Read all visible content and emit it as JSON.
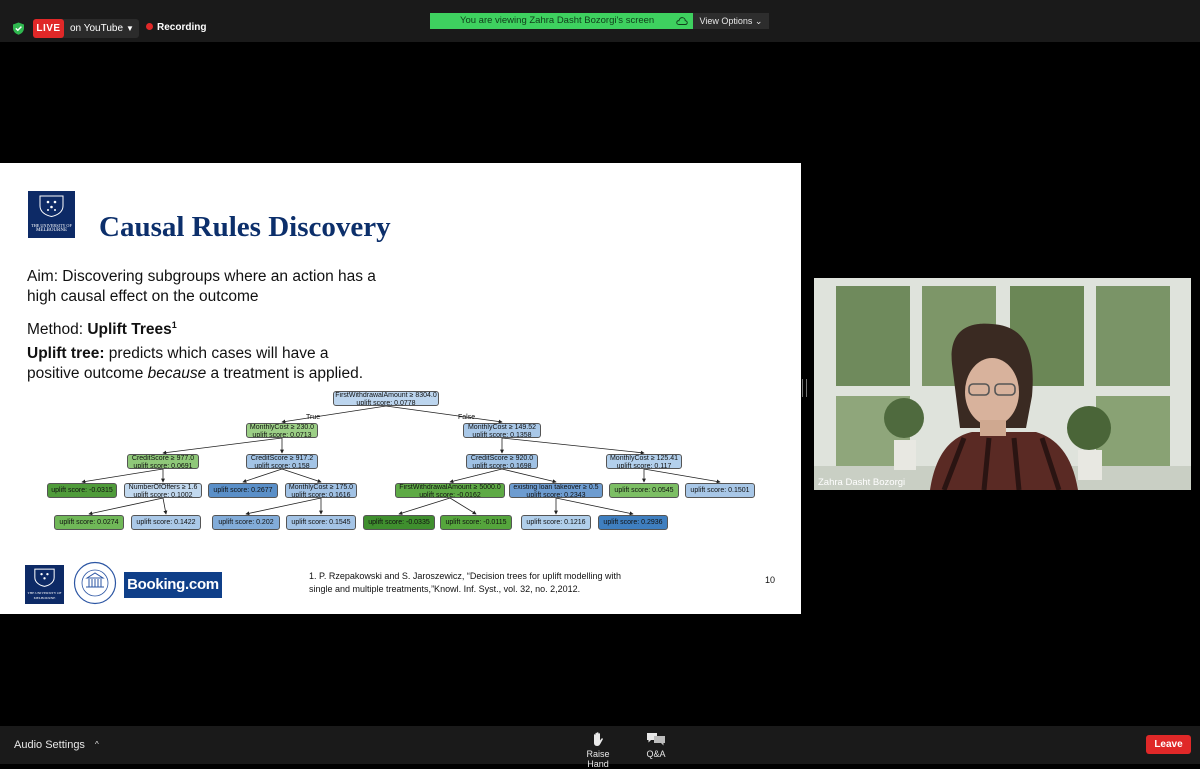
{
  "topbar": {
    "live_badge": "LIVE",
    "live_target": "on YouTube",
    "recording": "Recording",
    "viewing_banner": "You are viewing Zahra Dasht Bozorgi's screen",
    "view_options": "View Options ⌄"
  },
  "slide": {
    "crest_caption_1": "THE UNIVERSITY OF",
    "crest_caption_2": "MELBOURNE",
    "title": "Causal Rules Discovery",
    "aim_line1": "Aim: Discovering subgroups where an action has a",
    "aim_line2": "high causal effect on the outcome",
    "method_prefix": "Method: ",
    "method_bold": "Uplift Trees",
    "method_sup": "1",
    "uplift_bold": "Uplift tree:",
    "uplift_line1_rest": " predicts which cases will have a",
    "uplift_line2_a": "positive outcome ",
    "uplift_line2_em": "because",
    "uplift_line2_b": " a treatment is applied.",
    "tree": {
      "edge_true": "True",
      "edge_false": "False",
      "nodes": [
        {
          "id": "root",
          "l1": "FirstWithdrawalAmount ≥ 8304.0",
          "l2": "uplift score: 0.0778",
          "color": "#bcd5ee"
        },
        {
          "id": "n1",
          "l1": "MonthlyCost ≥ 230.0",
          "l2": "uplift score: 0.0713",
          "color": "#9ccf86"
        },
        {
          "id": "n2",
          "l1": "MonthlyCost ≥ 149.52",
          "l2": "uplift score: 0.1358",
          "color": "#a9c8e8"
        },
        {
          "id": "n3",
          "l1": "CreditScore ≥ 977.0",
          "l2": "uplift score: 0.0691",
          "color": "#8fc879"
        },
        {
          "id": "n4",
          "l1": "CreditScore ≥ 917.2",
          "l2": "uplift score: 0.158",
          "color": "#a3c4e6"
        },
        {
          "id": "n5",
          "l1": "CreditScore ≥ 920.0",
          "l2": "uplift score: 0.1698",
          "color": "#9fc1e4"
        },
        {
          "id": "n6",
          "l1": "MonthlyCost ≥ 125.41",
          "l2": "uplift score: 0.117",
          "color": "#b3d0ec"
        },
        {
          "id": "n7",
          "l1": "uplift score: -0.0315",
          "l2": "",
          "color": "#4f9b3a"
        },
        {
          "id": "n8",
          "l1": "NumberOfOffers ≥ 1.6",
          "l2": "uplift score: 0.1002",
          "color": "#c2d9ef"
        },
        {
          "id": "n9",
          "l1": "uplift score: 0.2677",
          "l2": "",
          "color": "#5a8fc8"
        },
        {
          "id": "n10",
          "l1": "MonthlyCost ≥ 175.0",
          "l2": "uplift score: 0.1616",
          "color": "#a1c2e5"
        },
        {
          "id": "n11",
          "l1": "FirstWithdrawalAmount ≥ 5000.0",
          "l2": "uplift score: -0.0162",
          "color": "#5eaa45"
        },
        {
          "id": "n12",
          "l1": "existing loan takeover ≥ 0.5",
          "l2": "uplift score: 0.2343",
          "color": "#6d9cd0"
        },
        {
          "id": "n13",
          "l1": "uplift score: 0.0545",
          "l2": "",
          "color": "#7cbe64"
        },
        {
          "id": "n14",
          "l1": "uplift score: 0.1501",
          "l2": "",
          "color": "#a8c7e7"
        },
        {
          "id": "n15",
          "l1": "uplift score: 0.0274",
          "l2": "",
          "color": "#70b858"
        },
        {
          "id": "n16",
          "l1": "uplift score: 0.1422",
          "l2": "",
          "color": "#abc9e8"
        },
        {
          "id": "n17",
          "l1": "uplift score: 0.202",
          "l2": "",
          "color": "#82acd9"
        },
        {
          "id": "n18",
          "l1": "uplift score: 0.1545",
          "l2": "",
          "color": "#a4c4e6"
        },
        {
          "id": "n19",
          "l1": "uplift score: -0.0335",
          "l2": "",
          "color": "#3f8f2e"
        },
        {
          "id": "n20",
          "l1": "uplift score: -0.0115",
          "l2": "",
          "color": "#55a53c"
        },
        {
          "id": "n21",
          "l1": "uplift score: 0.1216",
          "l2": "",
          "color": "#b1cfeb"
        },
        {
          "id": "n22",
          "l1": "uplift score: 0.2936",
          "l2": "",
          "color": "#3f7fc0"
        }
      ],
      "edges": [
        [
          "root",
          "n1"
        ],
        [
          "root",
          "n2"
        ],
        [
          "n1",
          "n3"
        ],
        [
          "n1",
          "n4"
        ],
        [
          "n2",
          "n5"
        ],
        [
          "n2",
          "n6"
        ],
        [
          "n3",
          "n7"
        ],
        [
          "n3",
          "n8"
        ],
        [
          "n4",
          "n9"
        ],
        [
          "n4",
          "n10"
        ],
        [
          "n5",
          "n11"
        ],
        [
          "n5",
          "n12"
        ],
        [
          "n6",
          "n13"
        ],
        [
          "n6",
          "n14"
        ],
        [
          "n8",
          "n15"
        ],
        [
          "n8",
          "n16"
        ],
        [
          "n10",
          "n17"
        ],
        [
          "n10",
          "n18"
        ],
        [
          "n11",
          "n19"
        ],
        [
          "n11",
          "n20"
        ],
        [
          "n12",
          "n21"
        ],
        [
          "n12",
          "n22"
        ]
      ]
    },
    "footer_crest_caption_1": "THE UNIVERSITY OF",
    "footer_crest_caption_2": "MELBOURNE",
    "booking_logo": "Booking.com",
    "reference_line1": "1.  P. Rzepakowski and S. Jaroszewicz, “Decision trees for uplift modelling with",
    "reference_line2": "single and multiple treatments,”Knowl. Inf. Syst., vol. 32, no. 2,2012.",
    "page_number": "10"
  },
  "video": {
    "participant_name": "Zahra Dasht Bozorgi"
  },
  "bottombar": {
    "audio_settings": "Audio Settings",
    "audio_caret": "^",
    "raise_hand": "Raise Hand",
    "qa": "Q&A",
    "leave": "Leave"
  },
  "colors": {
    "accent_green": "#3ed15f",
    "leave_red": "#e02828",
    "title_navy": "#0c2f6b",
    "booking_blue": "#0f3f89"
  }
}
